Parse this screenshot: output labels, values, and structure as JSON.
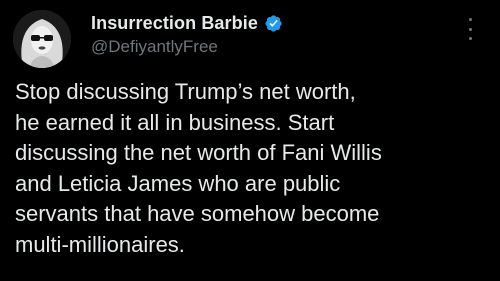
{
  "tweet": {
    "author": {
      "display_name": "Insurrection Barbie",
      "handle": "@DefiyantlyFree",
      "verified_icon": "verified-badge-icon",
      "avatar_icon": "profile-avatar"
    },
    "more_icon": "more-options-icon",
    "text_lines": [
      "Stop discussing Trump’s net worth,",
      "he earned it all in business. Start",
      "discussing the net worth of Fani Willis",
      "and Leticia James who are public",
      "servants that have somehow become",
      "multi-millionaires."
    ]
  },
  "colors": {
    "background": "#000000",
    "text_primary": "#e7e9ea",
    "text_secondary": "#71767b",
    "verified_blue": "#1d9bf0"
  }
}
